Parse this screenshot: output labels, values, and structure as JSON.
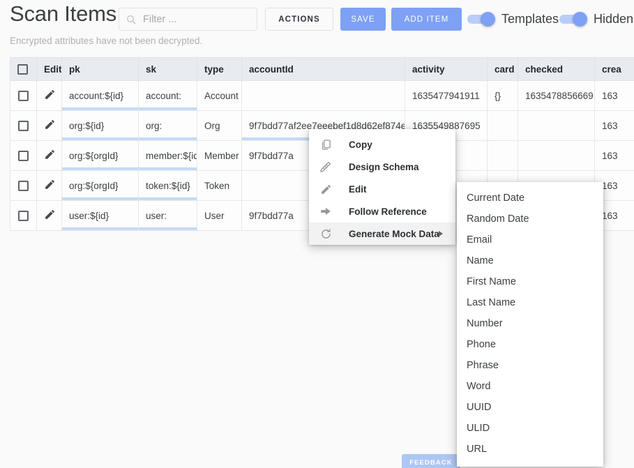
{
  "header": {
    "title": "Scan Items",
    "search": {
      "placeholder": "Filter ...",
      "value": "",
      "icon": "search-icon"
    },
    "buttons": {
      "actions": "ACTIONS",
      "save": "SAVE",
      "add_item": "ADD ITEM"
    },
    "toggles": [
      {
        "label": "Templates",
        "on": true
      },
      {
        "label": "Hidden",
        "on": true
      }
    ],
    "accent_color": "#7ea1f5"
  },
  "subtitle": "Encrypted attributes have not been decrypted.",
  "table": {
    "columns": [
      "",
      "Edit",
      "pk",
      "sk",
      "type",
      "accountId",
      "activity",
      "card",
      "checked",
      "crea"
    ],
    "rows": [
      {
        "pk": "account:${id}",
        "sk": "account:",
        "type": "Account",
        "accountId": "",
        "activity": "1635477941911",
        "card": "{}",
        "checked": "1635478856669",
        "crea": "163"
      },
      {
        "pk": "org:${id}",
        "sk": "org:",
        "type": "Org",
        "accountId": "9f7bdd77af2ee7eeebef1d8d62ef874e",
        "activity": "1635549887695",
        "card": "",
        "checked": "",
        "crea": "163"
      },
      {
        "pk": "org:${orgId}",
        "sk": "member:${id}",
        "type": "Member",
        "accountId": "9f7bdd77a",
        "activity": "",
        "card": "",
        "checked": "",
        "crea": "163"
      },
      {
        "pk": "org:${orgId}",
        "sk": "token:${id}",
        "type": "Token",
        "accountId": "",
        "activity": "",
        "card": "",
        "checked": "",
        "crea": "163"
      },
      {
        "pk": "user:${id}",
        "sk": "user:",
        "type": "User",
        "accountId": "9f7bdd77a",
        "activity": "",
        "card": "",
        "checked": "",
        "crea": "163"
      }
    ]
  },
  "context_menu": {
    "items": [
      {
        "label": "Copy",
        "icon": "copy-icon",
        "has_submenu": false,
        "active": false
      },
      {
        "label": "Design Schema",
        "icon": "ruler-icon",
        "has_submenu": false,
        "active": false
      },
      {
        "label": "Edit",
        "icon": "pencil-icon",
        "has_submenu": false,
        "active": false
      },
      {
        "label": "Follow Reference",
        "icon": "arrow-right-icon",
        "has_submenu": false,
        "active": false
      },
      {
        "label": "Generate Mock Data",
        "icon": "refresh-icon",
        "has_submenu": true,
        "active": true
      }
    ]
  },
  "submenu": {
    "items": [
      "Current Date",
      "Random Date",
      "Email",
      "Name",
      "First Name",
      "Last Name",
      "Number",
      "Phone",
      "Phrase",
      "Word",
      "UUID",
      "ULID",
      "URL"
    ]
  },
  "feedback": {
    "label": "FEEDBACK"
  }
}
